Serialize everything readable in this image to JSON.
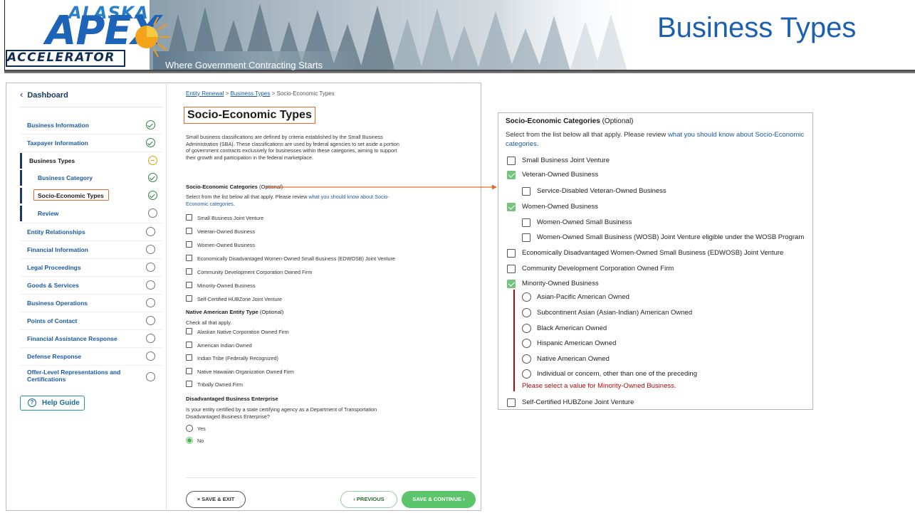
{
  "header": {
    "logo_top": "ALASKA",
    "logo_main": "APEX",
    "logo_bottom": "ACCELERATOR",
    "tagline": "Where Government Contracting Starts",
    "slide_title": "Business Types"
  },
  "sidebar": {
    "dashboard_label": "Dashboard",
    "items": [
      {
        "label": "Business Information",
        "status": "complete"
      },
      {
        "label": "Taxpayer Information",
        "status": "complete"
      },
      {
        "label": "Business Types",
        "status": "in-progress"
      },
      {
        "label": "Business Category",
        "status": "complete"
      },
      {
        "label": "Socio-Economic Types",
        "status": "complete"
      },
      {
        "label": "Review",
        "status": "not-started"
      },
      {
        "label": "Entity Relationships",
        "status": "not-started"
      },
      {
        "label": "Financial Information",
        "status": "not-started"
      },
      {
        "label": "Legal Proceedings",
        "status": "not-started"
      },
      {
        "label": "Goods & Services",
        "status": "not-started"
      },
      {
        "label": "Business Operations",
        "status": "not-started"
      },
      {
        "label": "Points of Contact",
        "status": "not-started"
      },
      {
        "label": "Financial Assistance Response",
        "status": "not-started"
      },
      {
        "label": "Defense Response",
        "status": "not-started"
      },
      {
        "label": "Offer-Level Representations and Certifications",
        "status": "not-started"
      }
    ],
    "help_label": "Help Guide"
  },
  "breadcrumb": {
    "items": [
      "Entity Renewal",
      "Business Types",
      "Socio-Economic Types"
    ],
    "separator": ">"
  },
  "form": {
    "page_title": "Socio-Economic Types",
    "intro": "Small business classifications are defined by criteria established by the Small Business Administration (SBA). These classifications are used by federal agencies to set aside a portion of government contracts exclusively for businesses within these categories, aiming to support their growth and participation in the federal marketplace.",
    "socio": {
      "heading": "Socio-Economic Categories",
      "optional": "(Optional)",
      "instruction": "Select from the list below all that apply. Please review ",
      "link": "what you should know about Socio-Economic categories",
      "options": [
        "Small Business Joint Venture",
        "Veteran-Owned Business",
        "Women-Owned Business",
        "Economically Disadvantaged Women-Owned Small Business (EDWOSB) Joint Venture",
        "Community Development Corporation Owned Firm",
        "Minority-Owned Business",
        "Self-Certified HUBZone Joint Venture"
      ]
    },
    "native": {
      "heading": "Native American Entity Type",
      "optional": "(Optional)",
      "instruction": "Check all that apply.",
      "options": [
        "Alaskan Native Corporation Owned Firm",
        "American Indian Owned",
        "Indian Tribe (Federally Recognized)",
        "Native Hawaiian Organization Owned Firm",
        "Tribally Owned Firm"
      ]
    },
    "dbe": {
      "heading": "Disadvantaged Business Enterprise",
      "question": "Is your entity certified by a state certifying agency as a Department of Transportation Disadvantaged Business Enterprise?",
      "options": [
        "Yes",
        "No"
      ],
      "selected": "No"
    },
    "buttons": {
      "exit": "× SAVE & EXIT",
      "previous": "‹ PREVIOUS",
      "next": "SAVE & CONTINUE ›"
    }
  },
  "zoom": {
    "heading": "Socio-Economic Categories",
    "optional": "(Optional)",
    "instruction": "Select from the list below all that apply. Please review ",
    "link": "what you should know about Socio-Economic categories",
    "period": ".",
    "items": [
      {
        "label": "Small Business Joint Venture",
        "checked": false
      },
      {
        "label": "Veteran-Owned Business",
        "checked": true
      },
      {
        "label": "Service-Disabled Veteran-Owned Business",
        "checked": false
      },
      {
        "label": "Women-Owned Business",
        "checked": true
      },
      {
        "label": "Women-Owned Small Business",
        "checked": false
      },
      {
        "label": "Women-Owned Small Business (WOSB) Joint Venture eligible under the WOSB Program",
        "checked": false
      },
      {
        "label": "Economically Disadvantaged Women-Owned Small Business (EDWOSB) Joint Venture",
        "checked": false
      },
      {
        "label": "Community Development Corporation Owned Firm",
        "checked": false
      },
      {
        "label": "Minority-Owned Business",
        "checked": true
      },
      {
        "label": "Self-Certified HUBZone Joint Venture",
        "checked": false
      }
    ],
    "minority_options": [
      "Asian-Pacific American Owned",
      "Subcontinent Asian (Asian-Indian) American Owned",
      "Black American Owned",
      "Hispanic American Owned",
      "Native American Owned",
      "Individual or concern, other than one of the preceding"
    ],
    "error": "Please select a value for Minority-Owned Business."
  },
  "colors": {
    "title_blue": "#1c5fb0",
    "link_blue": "#1b5aa6",
    "highlight_orange": "#e06a2c",
    "success_green": "#2e8540",
    "error_red": "#b50909"
  }
}
